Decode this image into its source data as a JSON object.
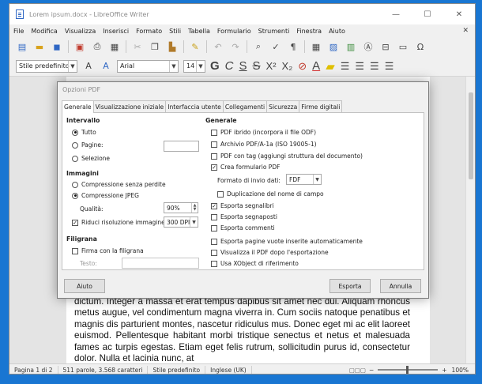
{
  "window": {
    "title": "Lorem ipsum.docx - LibreOffice Writer",
    "minimize": "—",
    "maximize": "☐",
    "close": "✕"
  },
  "menu": [
    "File",
    "Modifica",
    "Visualizza",
    "Inserisci",
    "Formato",
    "Stili",
    "Tabella",
    "Formulario",
    "Strumenti",
    "Finestra",
    "Aiuto"
  ],
  "formatting": {
    "style": "Stile predefinito",
    "font": "Arial",
    "size": "14"
  },
  "document_text": "dictum. Integer a massa et erat tempus dapibus sit amet nec dui. Aliquam rhoncus metus augue, vel condimentum magna viverra in. Cum sociis natoque penatibus et magnis dis parturient montes, nascetur ridiculus mus. Donec eget mi ac elit laoreet euismod. Pellentesque habitant morbi tristique senectus et netus et malesuada fames ac turpis egestas. Etiam eget felis rutrum, sollicitudin purus id, consectetur dolor. Nulla et lacinia nunc, at",
  "status": {
    "page": "Pagina 1 di 2",
    "words": "511 parole, 3.568 caratteri",
    "style": "Stile predefinito",
    "language": "Inglese (UK)",
    "zoom": "100%"
  },
  "dialog": {
    "title": "Opzioni PDF",
    "tabs": [
      "Generale",
      "Visualizzazione iniziale",
      "Interfaccia utente",
      "Collegamenti",
      "Sicurezza",
      "Firme digitali"
    ],
    "range": {
      "title": "Intervallo",
      "all": "Tutto",
      "pages": "Pagine:",
      "selection": "Selezione"
    },
    "images": {
      "title": "Immagini",
      "lossless": "Compressione senza perdite",
      "jpeg": "Compressione JPEG",
      "quality_label": "Qualità:",
      "quality_value": "90%",
      "reduce": "Riduci risoluzione immagine",
      "dpi": "300 DPI"
    },
    "watermark": {
      "title": "Filigrana",
      "sign": "Firma con la filigrana",
      "text_label": "Testo:"
    },
    "general": {
      "title": "Generale",
      "hybrid": "PDF ibrido (incorpora il file ODF)",
      "archive": "Archivio PDF/A-1a (ISO 19005-1)",
      "tagged": "PDF con tag (aggiungi struttura del documento)",
      "create_form": "Crea formulario PDF",
      "submit_label": "Formato di invio dati:",
      "submit_value": "FDF",
      "dup_names": "Duplicazione del nome di campo",
      "bookmarks": "Esporta segnalibri",
      "placeholders": "Esporta segnaposti",
      "comments": "Esporta commenti",
      "blank_pages": "Esporta pagine vuote inserite automaticamente",
      "view_after": "Visualizza il PDF dopo l'esportazione",
      "xobject": "Usa XObject di riferimento"
    },
    "buttons": {
      "help": "Aiuto",
      "export": "Esporta",
      "cancel": "Annulla"
    }
  }
}
